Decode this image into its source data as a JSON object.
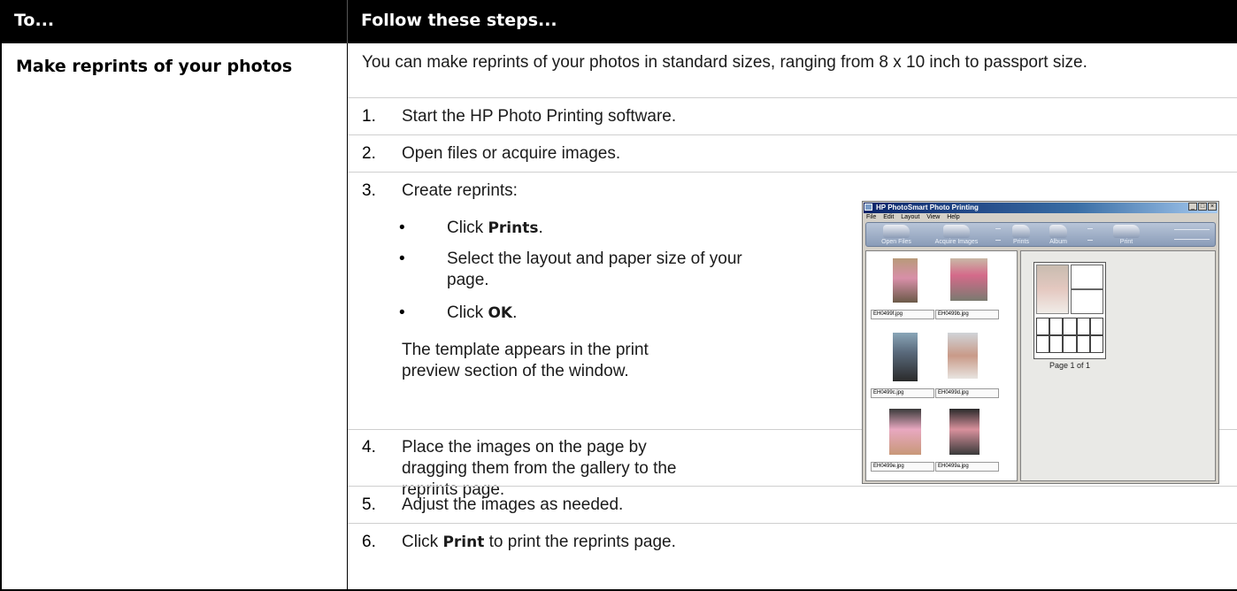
{
  "header": {
    "col1": "To...",
    "col2": "Follow these steps..."
  },
  "task": {
    "title": "Make reprints of your photos"
  },
  "intro": "You can make reprints of your photos in standard sizes, ranging from 8 x 10 inch to passport size.",
  "steps": [
    {
      "num": "1.",
      "text": "Start the HP Photo Printing software."
    },
    {
      "num": "2.",
      "text": "Open files or acquire images."
    },
    {
      "num": "3.",
      "text": "Create reprints:"
    },
    {
      "num": "4.",
      "text": "Place the images on the page by dragging them from the gallery to the reprints page."
    },
    {
      "num": "5.",
      "text": "Adjust the images as needed."
    },
    {
      "num": "6.",
      "pre": "Click ",
      "bold": "Print",
      "post": " to print the reprints page."
    }
  ],
  "substeps": [
    {
      "bullet": "•",
      "pre": "Click ",
      "bold": "Prints",
      "post": "."
    },
    {
      "bullet": "•",
      "pre": "Select the layout and paper size of your page.",
      "bold": "",
      "post": ""
    },
    {
      "bullet": "•",
      "pre": "Click ",
      "bold": "OK",
      "post": "."
    }
  ],
  "template_note": "The template appears in the print preview section of the window.",
  "screenshot": {
    "title": "HP PhotoSmart Photo Printing",
    "menu": [
      "File",
      "Edit",
      "Layout",
      "View",
      "Help"
    ],
    "window_buttons": [
      "_",
      "□",
      "×"
    ],
    "toolbar": [
      "Open Files",
      "Acquire Images",
      "Prints",
      "Album",
      "Print"
    ],
    "thumbnails": [
      "EH0499f.jpg",
      "EH0499b.jpg",
      "EH0499c.jpg",
      "EH0499d.jpg",
      "EH0499e.jpg",
      "EH0499a.jpg"
    ],
    "page_caption": "Page 1 of 1"
  }
}
